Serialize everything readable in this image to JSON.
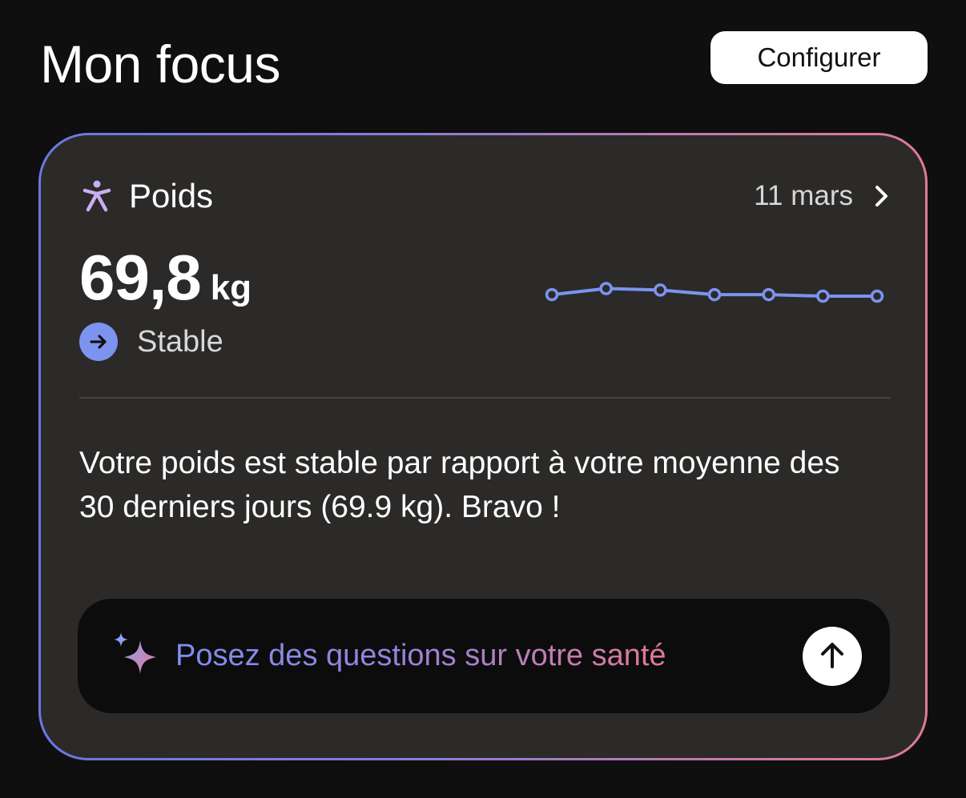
{
  "header": {
    "title": "Mon focus",
    "configure_label": "Configurer"
  },
  "card": {
    "metric_icon": "person-icon",
    "metric_label": "Poids",
    "date": "11 mars",
    "date_icon": "chevron-right-icon",
    "value": "69,8",
    "unit": "kg",
    "trend_icon": "arrow-right-icon",
    "trend_label": "Stable",
    "summary": "Votre poids est stable par rapport à votre moyenne des 30 derniers jours (69.9 kg). Bravo !",
    "colors": {
      "accent": "#7d93f0",
      "card_bg": "#2b2a28",
      "border_start": "#6a78e0",
      "border_end": "#e07a93"
    }
  },
  "assistant": {
    "icon": "sparkle-icon",
    "prompt": "Posez des questions sur votre santé",
    "send_icon": "arrow-up-icon"
  },
  "chart_data": {
    "type": "line",
    "title": "",
    "xlabel": "",
    "ylabel": "",
    "x": [
      1,
      2,
      3,
      4,
      5,
      6,
      7
    ],
    "values": [
      69.85,
      70.05,
      70.0,
      69.85,
      69.85,
      69.8,
      69.8
    ],
    "ylim": [
      69.3,
      70.3
    ],
    "grid": false,
    "color": "#7d93f0"
  }
}
